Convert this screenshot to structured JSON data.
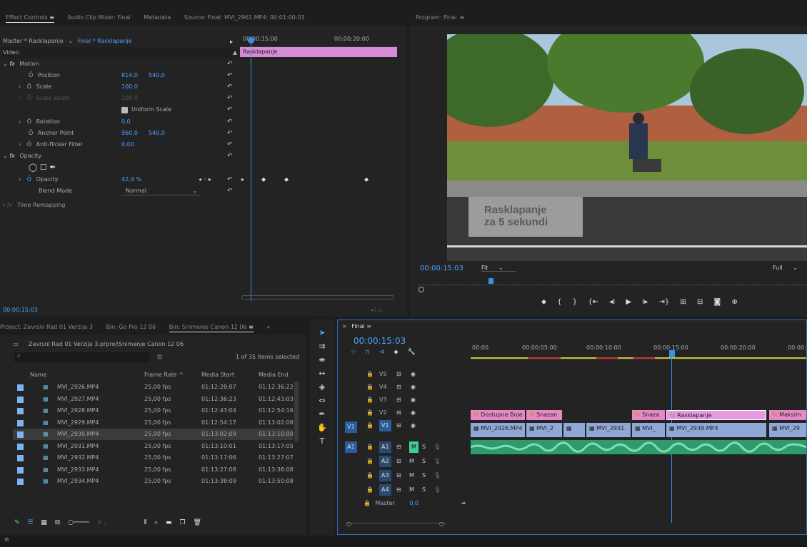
{
  "effect_controls": {
    "tabs": [
      "Effect Controls",
      "Audio Clip Mixer: Final",
      "Metadata",
      "Source: Final: MVI_2961.MP4: 00:01:00:03"
    ],
    "master": "Master * Rasklapanje",
    "sequence": "Final * Rasklapanje",
    "ruler": [
      "00:00:15:00",
      "00:00:20:00"
    ],
    "clip_label": "Rasklapanje",
    "section": "Video",
    "motion": "Motion",
    "position": {
      "label": "Position",
      "x": "814,0",
      "y": "540,0"
    },
    "scale": {
      "label": "Scale",
      "value": "100,0"
    },
    "scale_width": {
      "label": "Scale Width",
      "value": "100,0"
    },
    "uniform_scale": "Uniform Scale",
    "rotation": {
      "label": "Rotation",
      "value": "0,0"
    },
    "anchor": {
      "label": "Anchor Point",
      "x": "960,0",
      "y": "540,0"
    },
    "antiflicker": {
      "label": "Anti-flicker Filter",
      "value": "0,00"
    },
    "opacity_section": "Opacity",
    "opacity": {
      "label": "Opacity",
      "value": "42,9 %"
    },
    "blend": {
      "label": "Blend Mode",
      "value": "Normal"
    },
    "time_remap": "Time Remapping",
    "timecode": "00:00:15:03"
  },
  "program": {
    "title": "Program: Final",
    "overlay_line1": "Rasklapanje",
    "overlay_line2": "za 5 sekundi",
    "timecode": "00:00:15:03",
    "fit": "Fit",
    "quality": "Full"
  },
  "project": {
    "tabs": [
      "Project: Zavrsni Rad 01 Verzija 3",
      "Bin: Go Pro 12 06",
      "Bin: Snimanje Canon 12 06"
    ],
    "path": "Zavrsni Rad 01 Verzija 3.prproj\\Snimanje Canon 12 06",
    "selected": "1 of 35 items selected",
    "headers": [
      "Name",
      "Frame Rate",
      "Media Start",
      "Media End"
    ],
    "rows": [
      [
        "MVI_2926.MP4",
        "25,00 fps",
        "01:12:28:07",
        "01:12:36:22"
      ],
      [
        "MVI_2927.MP4",
        "25,00 fps",
        "01:12:36:23",
        "01:12:43:03"
      ],
      [
        "MVI_2928.MP4",
        "25,00 fps",
        "01:12:43:04",
        "01:12:54:16"
      ],
      [
        "MVI_2929.MP4",
        "25,00 fps",
        "01:12:54:17",
        "01:13:02:08"
      ],
      [
        "MVI_2930.MP4",
        "25,00 fps",
        "01:13:02:09",
        "01:13:10:00"
      ],
      [
        "MVI_2931.MP4",
        "25,00 fps",
        "01:13:10:01",
        "01:13:17:05"
      ],
      [
        "MVI_2932.MP4",
        "25,00 fps",
        "01:13:17:06",
        "01:13:27:07"
      ],
      [
        "MVI_2933.MP4",
        "25,00 fps",
        "01:13:27:08",
        "01:13:38:08"
      ],
      [
        "MVI_2934.MP4",
        "25,00 fps",
        "01:13:38:09",
        "01:13:50:08"
      ]
    ]
  },
  "timeline": {
    "title": "Final",
    "timecode": "00:00:15:03",
    "ruler": [
      "00:00",
      "00:00:05:00",
      "00:00:10:00",
      "00:00:15:00",
      "00:00:20:00",
      "00:00:2"
    ],
    "tracks_video": [
      "V5",
      "V4",
      "V3",
      "V2",
      "V1"
    ],
    "tracks_audio": [
      "A1",
      "A2",
      "A3",
      "A4"
    ],
    "master": "Master",
    "master_val": "0,0",
    "v2_clips": [
      "Dostupne Boje",
      "Snazan",
      "Snaza",
      "Rasklapanje",
      "Maksim"
    ],
    "v1_clips": [
      "MVI_2926.MP4",
      "MVI_2",
      "MVI_2931.",
      "MVI_",
      "MVI_2939.MP4",
      "MVI_29"
    ]
  }
}
